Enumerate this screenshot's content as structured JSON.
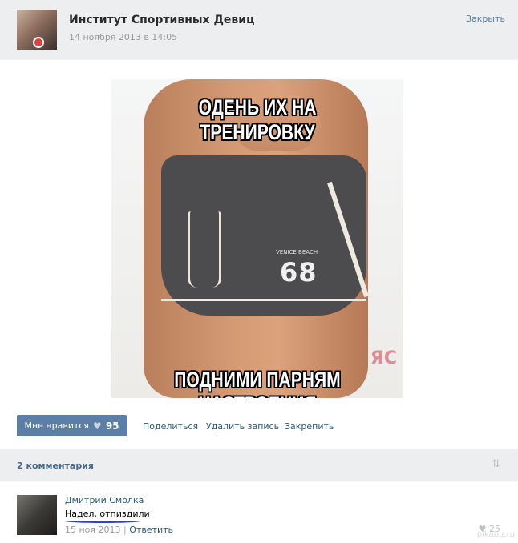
{
  "post": {
    "group_name": "Институт Спортивных Девиц",
    "date": "14 ноября 2013 в 14:05",
    "close_label": "Закрыть",
    "meme_top": "ОДЕНЬ ИХ НА ТРЕНИРОВКУ",
    "meme_bottom": "ПОДНИМИ  ПАРНЯМ НАСТРОЕНИЯ",
    "shorts_number": "68",
    "shorts_brand": "VENICE BEACH",
    "watermark": "ЯС"
  },
  "actions": {
    "like_label": "Мне нравится",
    "like_count": "95",
    "share_label": "Поделиться",
    "delete_label": "Удалить запись",
    "pin_label": "Закрепить"
  },
  "comments": {
    "count_label": "2 комментария",
    "items": [
      {
        "author": "Дмитрий Смолка",
        "text": "Надел, отпиздили",
        "date": "15 ноя 2013",
        "separator": "|",
        "reply_label": "Ответить",
        "likes": "25"
      }
    ]
  },
  "footer": {
    "source": "pikabu.ru"
  },
  "colors": {
    "accent": "#5b7fa6",
    "link": "#2b587a",
    "header_bg": "#edeef0"
  },
  "icons": [
    "heart-icon",
    "sort-icon"
  ]
}
